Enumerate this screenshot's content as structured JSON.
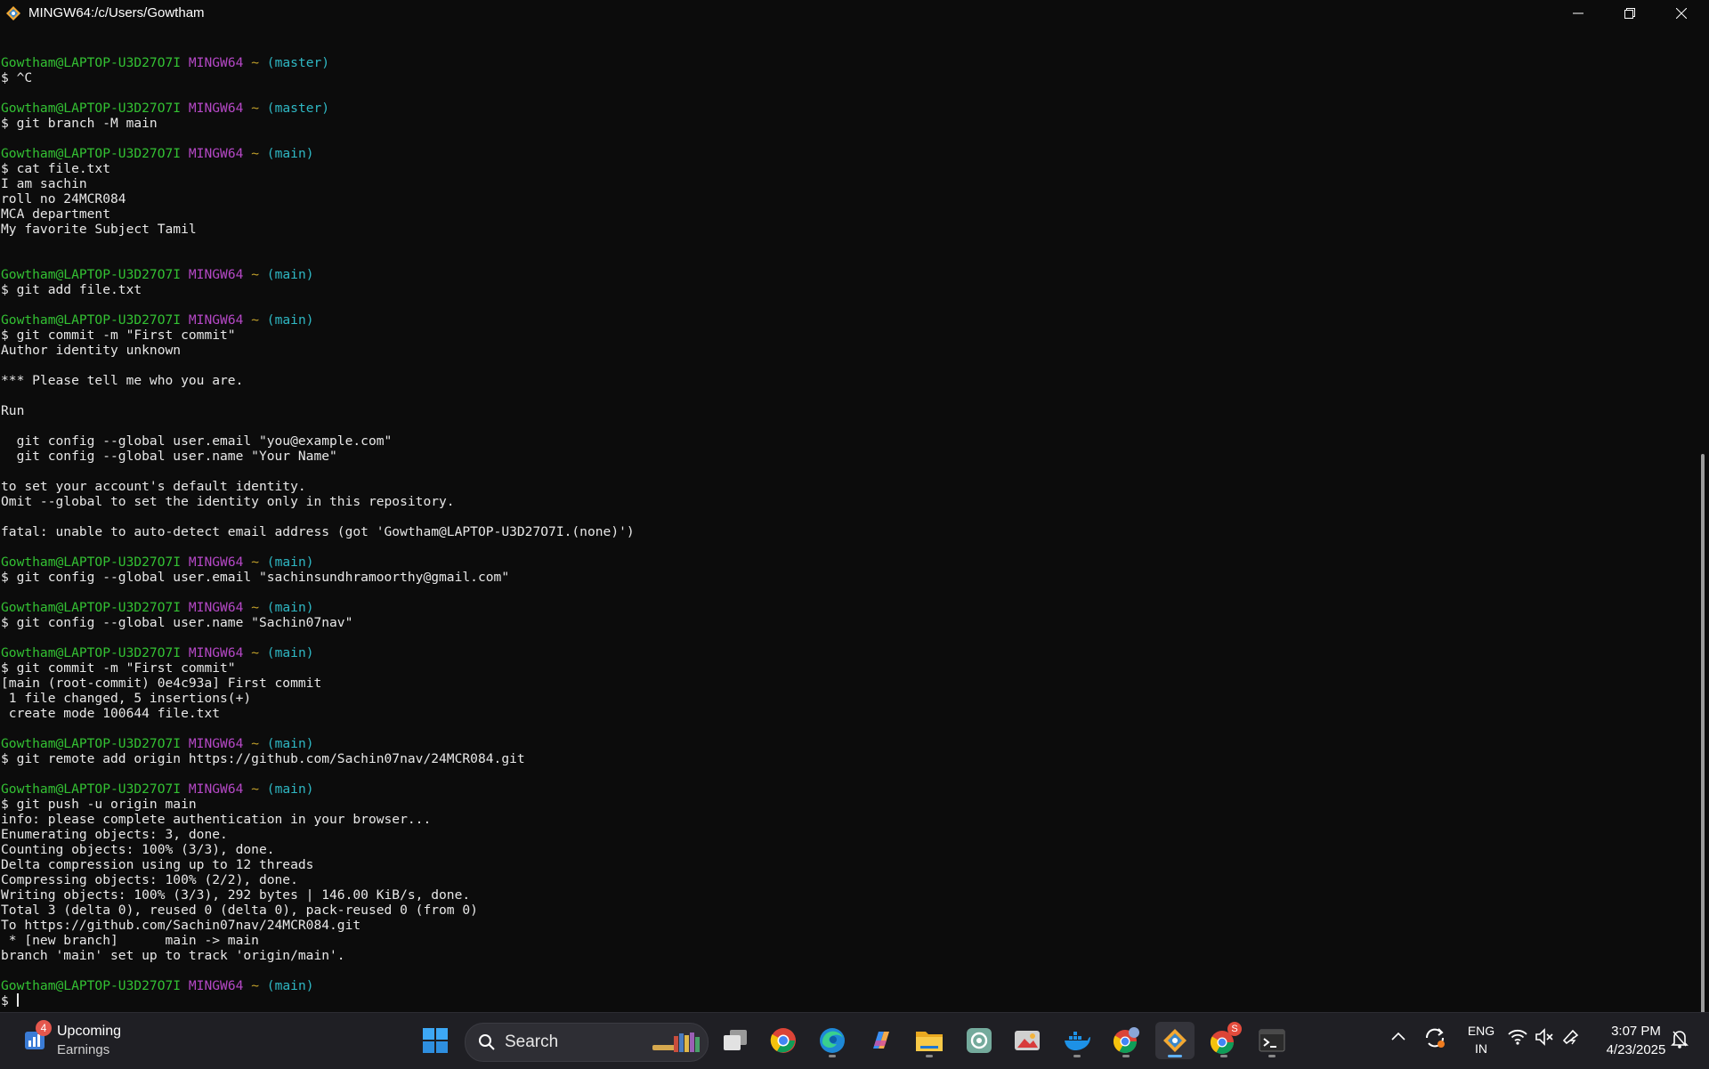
{
  "window": {
    "title": "MINGW64:/c/Users/Gowtham",
    "minimize_glyph": "─",
    "maximize_glyph": "❐",
    "close_glyph": "✕"
  },
  "prompt": {
    "user": "Gowtham@LAPTOP-U3D27O7I",
    "system": "MINGW64",
    "path": "~"
  },
  "terminal_blocks": [
    {
      "branch": "(master)",
      "lines": [
        "$ ^C",
        ""
      ]
    },
    {
      "branch": "(master)",
      "lines": [
        "$ git branch -M main",
        ""
      ]
    },
    {
      "branch": "(main)",
      "lines": [
        "$ cat file.txt",
        "I am sachin",
        "roll no 24MCR084",
        "MCA department",
        "My favorite Subject Tamil",
        "",
        ""
      ]
    },
    {
      "branch": "(main)",
      "lines": [
        "$ git add file.txt",
        ""
      ]
    },
    {
      "branch": "(main)",
      "lines": [
        "$ git commit -m \"First commit\"",
        "Author identity unknown",
        "",
        "*** Please tell me who you are.",
        "",
        "Run",
        "",
        "  git config --global user.email \"you@example.com\"",
        "  git config --global user.name \"Your Name\"",
        "",
        "to set your account's default identity.",
        "Omit --global to set the identity only in this repository.",
        "",
        "fatal: unable to auto-detect email address (got 'Gowtham@LAPTOP-U3D27O7I.(none)')",
        ""
      ]
    },
    {
      "branch": "(main)",
      "lines": [
        "$ git config --global user.email \"sachinsundhramoorthy@gmail.com\"",
        ""
      ]
    },
    {
      "branch": "(main)",
      "lines": [
        "$ git config --global user.name \"Sachin07nav\"",
        ""
      ]
    },
    {
      "branch": "(main)",
      "lines": [
        "$ git commit -m \"First commit\"",
        "[main (root-commit) 0e4c93a] First commit",
        " 1 file changed, 5 insertions(+)",
        " create mode 100644 file.txt",
        ""
      ]
    },
    {
      "branch": "(main)",
      "lines": [
        "$ git remote add origin https://github.com/Sachin07nav/24MCR084.git",
        ""
      ]
    },
    {
      "branch": "(main)",
      "lines": [
        "$ git push -u origin main",
        "info: please complete authentication in your browser...",
        "Enumerating objects: 3, done.",
        "Counting objects: 100% (3/3), done.",
        "Delta compression using up to 12 threads",
        "Compressing objects: 100% (2/2), done.",
        "Writing objects: 100% (3/3), 292 bytes | 146.00 KiB/s, done.",
        "Total 3 (delta 0), reused 0 (delta 0), pack-reused 0 (from 0)",
        "To https://github.com/Sachin07nav/24MCR084.git",
        " * [new branch]      main -> main",
        "branch 'main' set up to track 'origin/main'.",
        ""
      ]
    },
    {
      "branch": "(main)",
      "lines": [
        "$ "
      ]
    }
  ],
  "colors": {
    "prompt_user": "#33c133",
    "prompt_system": "#b548c6",
    "prompt_path": "#c3a12b",
    "prompt_branch": "#2fb8c4",
    "terminal_bg": "#0c0c0c",
    "terminal_fg": "#e8e8e8"
  },
  "taskbar": {
    "widget": {
      "title": "Upcoming",
      "subtitle": "Earnings",
      "badge": "4"
    },
    "search_placeholder": "Search",
    "apps": [
      {
        "name": "start-icon"
      },
      {
        "name": "task-view-icon"
      },
      {
        "name": "chrome-icon"
      },
      {
        "name": "edge-icon"
      },
      {
        "name": "copilot-icon"
      },
      {
        "name": "file-explorer-icon"
      },
      {
        "name": "chatgpt-icon"
      },
      {
        "name": "photos-icon"
      },
      {
        "name": "docker-icon"
      },
      {
        "name": "chrome-profile-icon"
      },
      {
        "name": "git-bash-icon",
        "active": true
      },
      {
        "name": "chrome-badge-icon",
        "badge": "S"
      },
      {
        "name": "terminal-icon"
      }
    ],
    "tray": {
      "chevron": "^",
      "language_line1": "ENG",
      "language_line2": "IN",
      "time": "3:07 PM",
      "date": "4/23/2025"
    }
  }
}
